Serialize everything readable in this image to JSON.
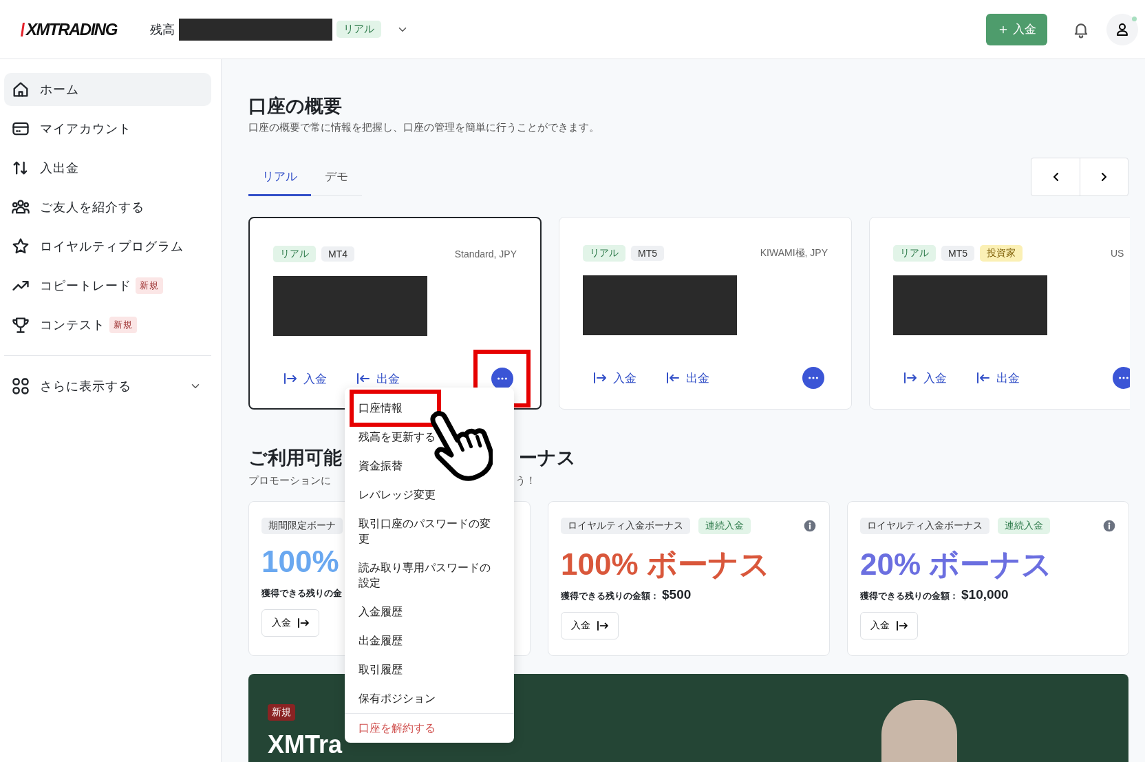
{
  "header": {
    "logo": "XMTRADING",
    "balance_label": "残高",
    "account_badge": "リアル",
    "deposit_button": "入金"
  },
  "sidebar": {
    "items": [
      {
        "label": "ホーム",
        "selected": true
      },
      {
        "label": "マイアカウント",
        "selected": false
      },
      {
        "label": "入出金",
        "selected": false
      },
      {
        "label": "ご友人を紹介する",
        "selected": false
      },
      {
        "label": "ロイヤルティプログラム",
        "selected": false
      },
      {
        "label": "コピートレード",
        "badge": "新規",
        "selected": false
      },
      {
        "label": "コンテスト",
        "badge": "新規",
        "selected": false
      }
    ],
    "more": {
      "label": "さらに表示する",
      "expanded": false
    }
  },
  "overview": {
    "title": "口座の概要",
    "subtitle": "口座の概要で常に情報を把握し、口座の管理を簡単に行うことができます。",
    "tabs": [
      {
        "label": "リアル",
        "selected": true
      },
      {
        "label": "デモ",
        "selected": false
      }
    ],
    "accounts": [
      {
        "tags": [
          {
            "label": "リアル",
            "kind": "real"
          },
          {
            "label": "MT4",
            "kind": "platform"
          }
        ],
        "meta": "Standard, JPY",
        "selected": true,
        "highlighted": true,
        "actions": [
          {
            "label": "入金",
            "kind": "deposit"
          },
          {
            "label": "出金",
            "kind": "withdraw"
          }
        ]
      },
      {
        "tags": [
          {
            "label": "リアル",
            "kind": "real"
          },
          {
            "label": "MT5",
            "kind": "platform"
          }
        ],
        "meta": "KIWAMI極, JPY",
        "selected": false,
        "highlighted": false,
        "actions": [
          {
            "label": "入金",
            "kind": "deposit"
          },
          {
            "label": "出金",
            "kind": "withdraw"
          }
        ]
      },
      {
        "tags": [
          {
            "label": "リアル",
            "kind": "real"
          },
          {
            "label": "MT5",
            "kind": "platform"
          },
          {
            "label": "投資家",
            "kind": "investor"
          }
        ],
        "meta": "US",
        "selected": false,
        "highlighted": false,
        "actions": [
          {
            "label": "入金",
            "kind": "deposit"
          },
          {
            "label": "出金",
            "kind": "withdraw"
          }
        ]
      }
    ]
  },
  "menu": {
    "items": [
      {
        "label": "口座情報",
        "kind": "normal",
        "highlighted": true
      },
      {
        "label": "残高を更新する",
        "kind": "normal",
        "highlighted": false
      },
      {
        "label": "資金振替",
        "kind": "normal",
        "highlighted": false
      },
      {
        "label": "レバレッジ変更",
        "kind": "normal",
        "highlighted": false
      },
      {
        "label": "取引口座のパスワードの変更",
        "kind": "normal",
        "highlighted": false
      },
      {
        "label": "読み取り専用パスワードの設定",
        "kind": "normal",
        "highlighted": false
      },
      {
        "label": "入金履歴",
        "kind": "normal",
        "highlighted": false
      },
      {
        "label": "出金履歴",
        "kind": "normal",
        "highlighted": false
      },
      {
        "label": "取引履歴",
        "kind": "normal",
        "highlighted": false
      },
      {
        "label": "保有ポジション",
        "kind": "normal",
        "highlighted": false
      },
      {
        "label": "口座を解約する",
        "kind": "danger",
        "highlighted": false
      }
    ]
  },
  "bonus": {
    "title_parts": [
      "ご利用可能",
      "ーナス"
    ],
    "subtitle_parts": [
      "プロモーションに",
      "う！"
    ],
    "cards": [
      {
        "tags": [
          {
            "label": "期間限定ボーナ",
            "kind": "promo"
          }
        ],
        "headline": "100%",
        "color": "#6aa8f0",
        "remaining_label": "獲得できる残りの金",
        "button": "入金",
        "info": false
      },
      {
        "tags": [
          {
            "label": "ロイヤルティ入金ボーナス",
            "kind": "promo"
          },
          {
            "label": "連続入金",
            "kind": "deposit"
          }
        ],
        "headline": "100% ボーナス",
        "color": "#d9573b",
        "remaining_label": "獲得できる残りの金額：",
        "amount": "$500",
        "button": "入金",
        "info": true
      },
      {
        "tags": [
          {
            "label": "ロイヤルティ入金ボーナス",
            "kind": "promo"
          },
          {
            "label": "連続入金",
            "kind": "deposit"
          }
        ],
        "headline": "20% ボーナス",
        "color": "#6b6fe0",
        "remaining_label": "獲得できる残りの金額：",
        "amount": "$10,000",
        "button": "入金",
        "info": true
      }
    ]
  },
  "banner": {
    "badge": "新規",
    "title": "XMTra"
  }
}
